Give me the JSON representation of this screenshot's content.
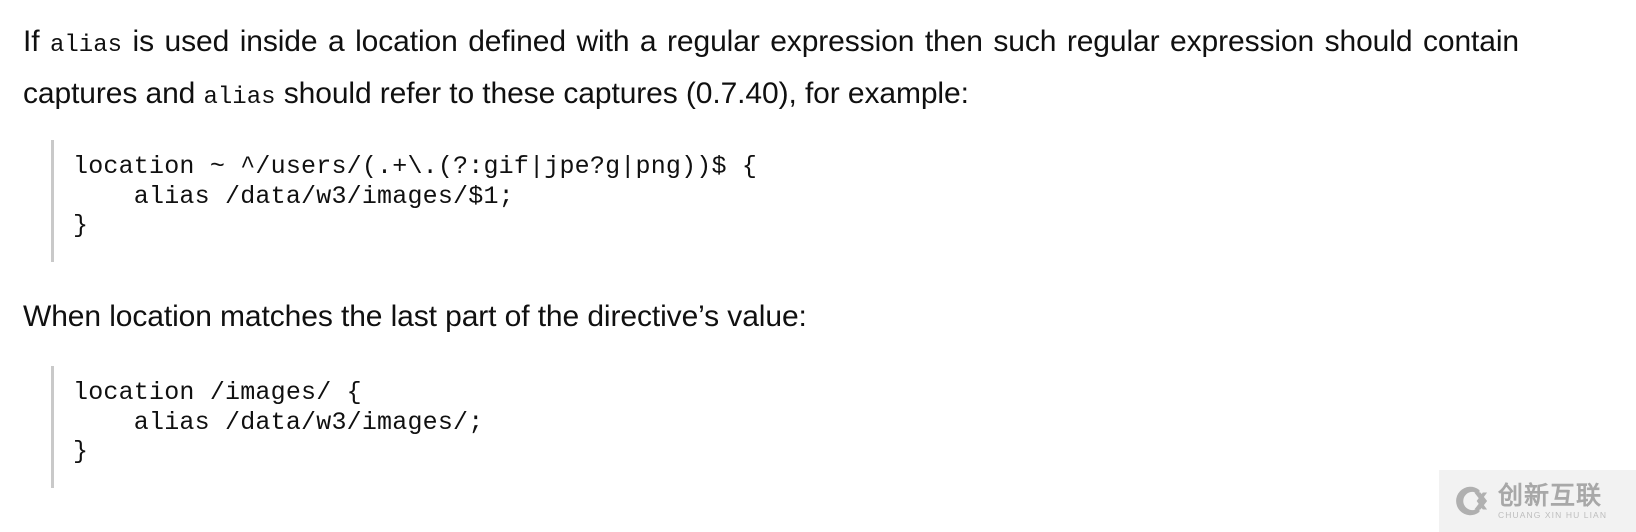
{
  "page": {
    "background_color": "#ffffff",
    "text_color": "#101010"
  },
  "paragraph_1": {
    "segment_1": "If ",
    "code_1": "alias",
    "segment_2": " is used inside a location defined with a regular expression then such regular expression should ",
    "segment_3": "contain captures and ",
    "code_2": "alias",
    "segment_4": " should refer to these captures (0.7.40), for example:"
  },
  "code_block_1": {
    "border_color": "#c9c9c9",
    "line_1": "location ~ ^/users/(.+\\.(?:gif|jpe?g|png))$ {",
    "line_2": "    alias /data/w3/images/$1;",
    "line_3": "}"
  },
  "paragraph_2": {
    "text": "When location matches the last part of the directive’s value:"
  },
  "code_block_2": {
    "border_color": "#c9c9c9",
    "line_1": "location /images/ {",
    "line_2": "    alias /data/w3/images/;",
    "line_3": "}"
  },
  "watermark": {
    "logo_icon": "cx-circle-logo-icon",
    "chinese_text": "创新互联",
    "pinyin_text": "CHUANG XIN HU LIAN",
    "background_color": "#f2f2f2",
    "text_color": "#a8a8a8"
  }
}
